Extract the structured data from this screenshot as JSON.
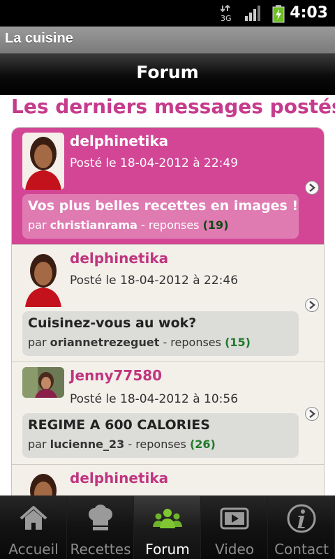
{
  "status": {
    "time": "4:03",
    "network": "3G"
  },
  "app": {
    "title": "La cuisine"
  },
  "header": {
    "title": "Forum"
  },
  "main": {
    "heading": "Les derniers messages postés",
    "posts": [
      {
        "author": "delphinetika",
        "date": "Posté le 18-04-2012 à 22:49",
        "subject": "Vos plus belles recettes en images !",
        "by_label": "par",
        "by_user": "christianrama",
        "replies_label": "- reponses",
        "replies": "(19)"
      },
      {
        "author": "delphinetika",
        "date": "Posté le 18-04-2012 à 22:46",
        "subject": "Cuisinez-vous au wok?",
        "by_label": "par",
        "by_user": "oriannetrezeguet",
        "replies_label": "- reponses",
        "replies": "(15)"
      },
      {
        "author": "Jenny77580",
        "date": "Posté le 18-04-2012 à 10:56",
        "subject": "REGIME A 600 CALORIES",
        "by_label": "par",
        "by_user": "lucienne_23",
        "replies_label": "- reponses",
        "replies": "(26)"
      },
      {
        "author": "delphinetika"
      }
    ]
  },
  "tabs": [
    {
      "label": "Accueil",
      "icon": "home-icon"
    },
    {
      "label": "Recettes",
      "icon": "chef-hat-icon"
    },
    {
      "label": "Forum",
      "icon": "users-icon",
      "active": true
    },
    {
      "label": "Video",
      "icon": "video-icon"
    },
    {
      "label": "Contact",
      "icon": "info-icon"
    }
  ],
  "colors": {
    "accent": "#d34695",
    "title_pink": "#c63b8c",
    "reply_green": "#1f7a2b"
  }
}
